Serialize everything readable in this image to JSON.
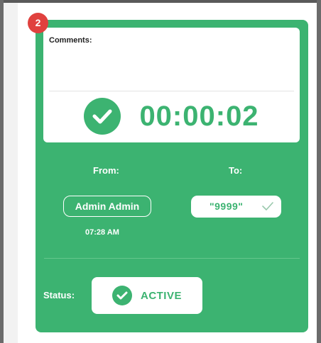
{
  "badge": {
    "count": "2"
  },
  "comments": {
    "label": "Comments:",
    "value": ""
  },
  "timer": {
    "elapsed": "00:00:02",
    "icon": "check-circle-icon"
  },
  "from": {
    "label": "From:",
    "name": "Admin Admin",
    "time": "07:28 AM"
  },
  "to": {
    "label": "To:",
    "value": "\"9999\"",
    "icon": "checkmark-icon"
  },
  "status": {
    "label": "Status:",
    "value": "ACTIVE",
    "icon": "check-circle-icon"
  },
  "colors": {
    "accent": "#3cb371",
    "badge": "#e0413e",
    "surface": "#ffffff"
  }
}
